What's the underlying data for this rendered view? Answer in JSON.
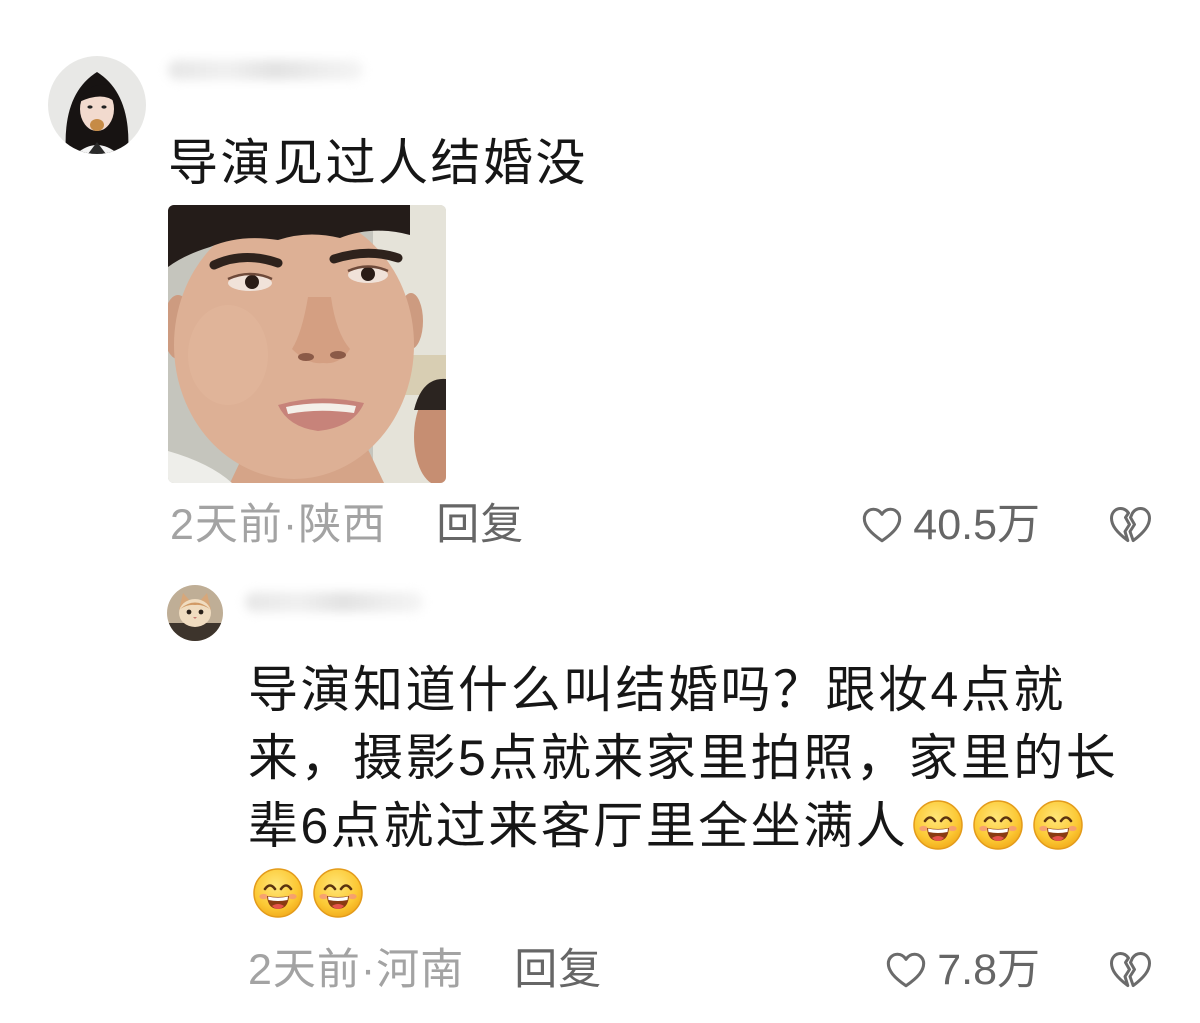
{
  "comment": {
    "text": "导演见过人结婚没",
    "meta": "2天前·陕西",
    "reply_label": "回复",
    "like_count": "40.5万"
  },
  "reply": {
    "text": "导演知道什么叫结婚吗？跟妆4点就来，摄影5点就来家里拍照，家里的长辈6点就过来客厅里全坐满人",
    "emojis": [
      "grinning-face-icon",
      "grinning-face-icon",
      "grinning-face-icon",
      "grinning-face-icon",
      "grinning-face-icon"
    ],
    "meta": "2天前·河南",
    "reply_label": "回复",
    "like_count": "7.8万"
  },
  "icons": {
    "like": "heart-outline-icon",
    "dislike": "broken-heart-icon"
  },
  "colors": {
    "background": "#ffffff",
    "text": "#161616",
    "meta": "#a3a3a3",
    "action": "#666666",
    "icon": "#6b6b6b"
  }
}
